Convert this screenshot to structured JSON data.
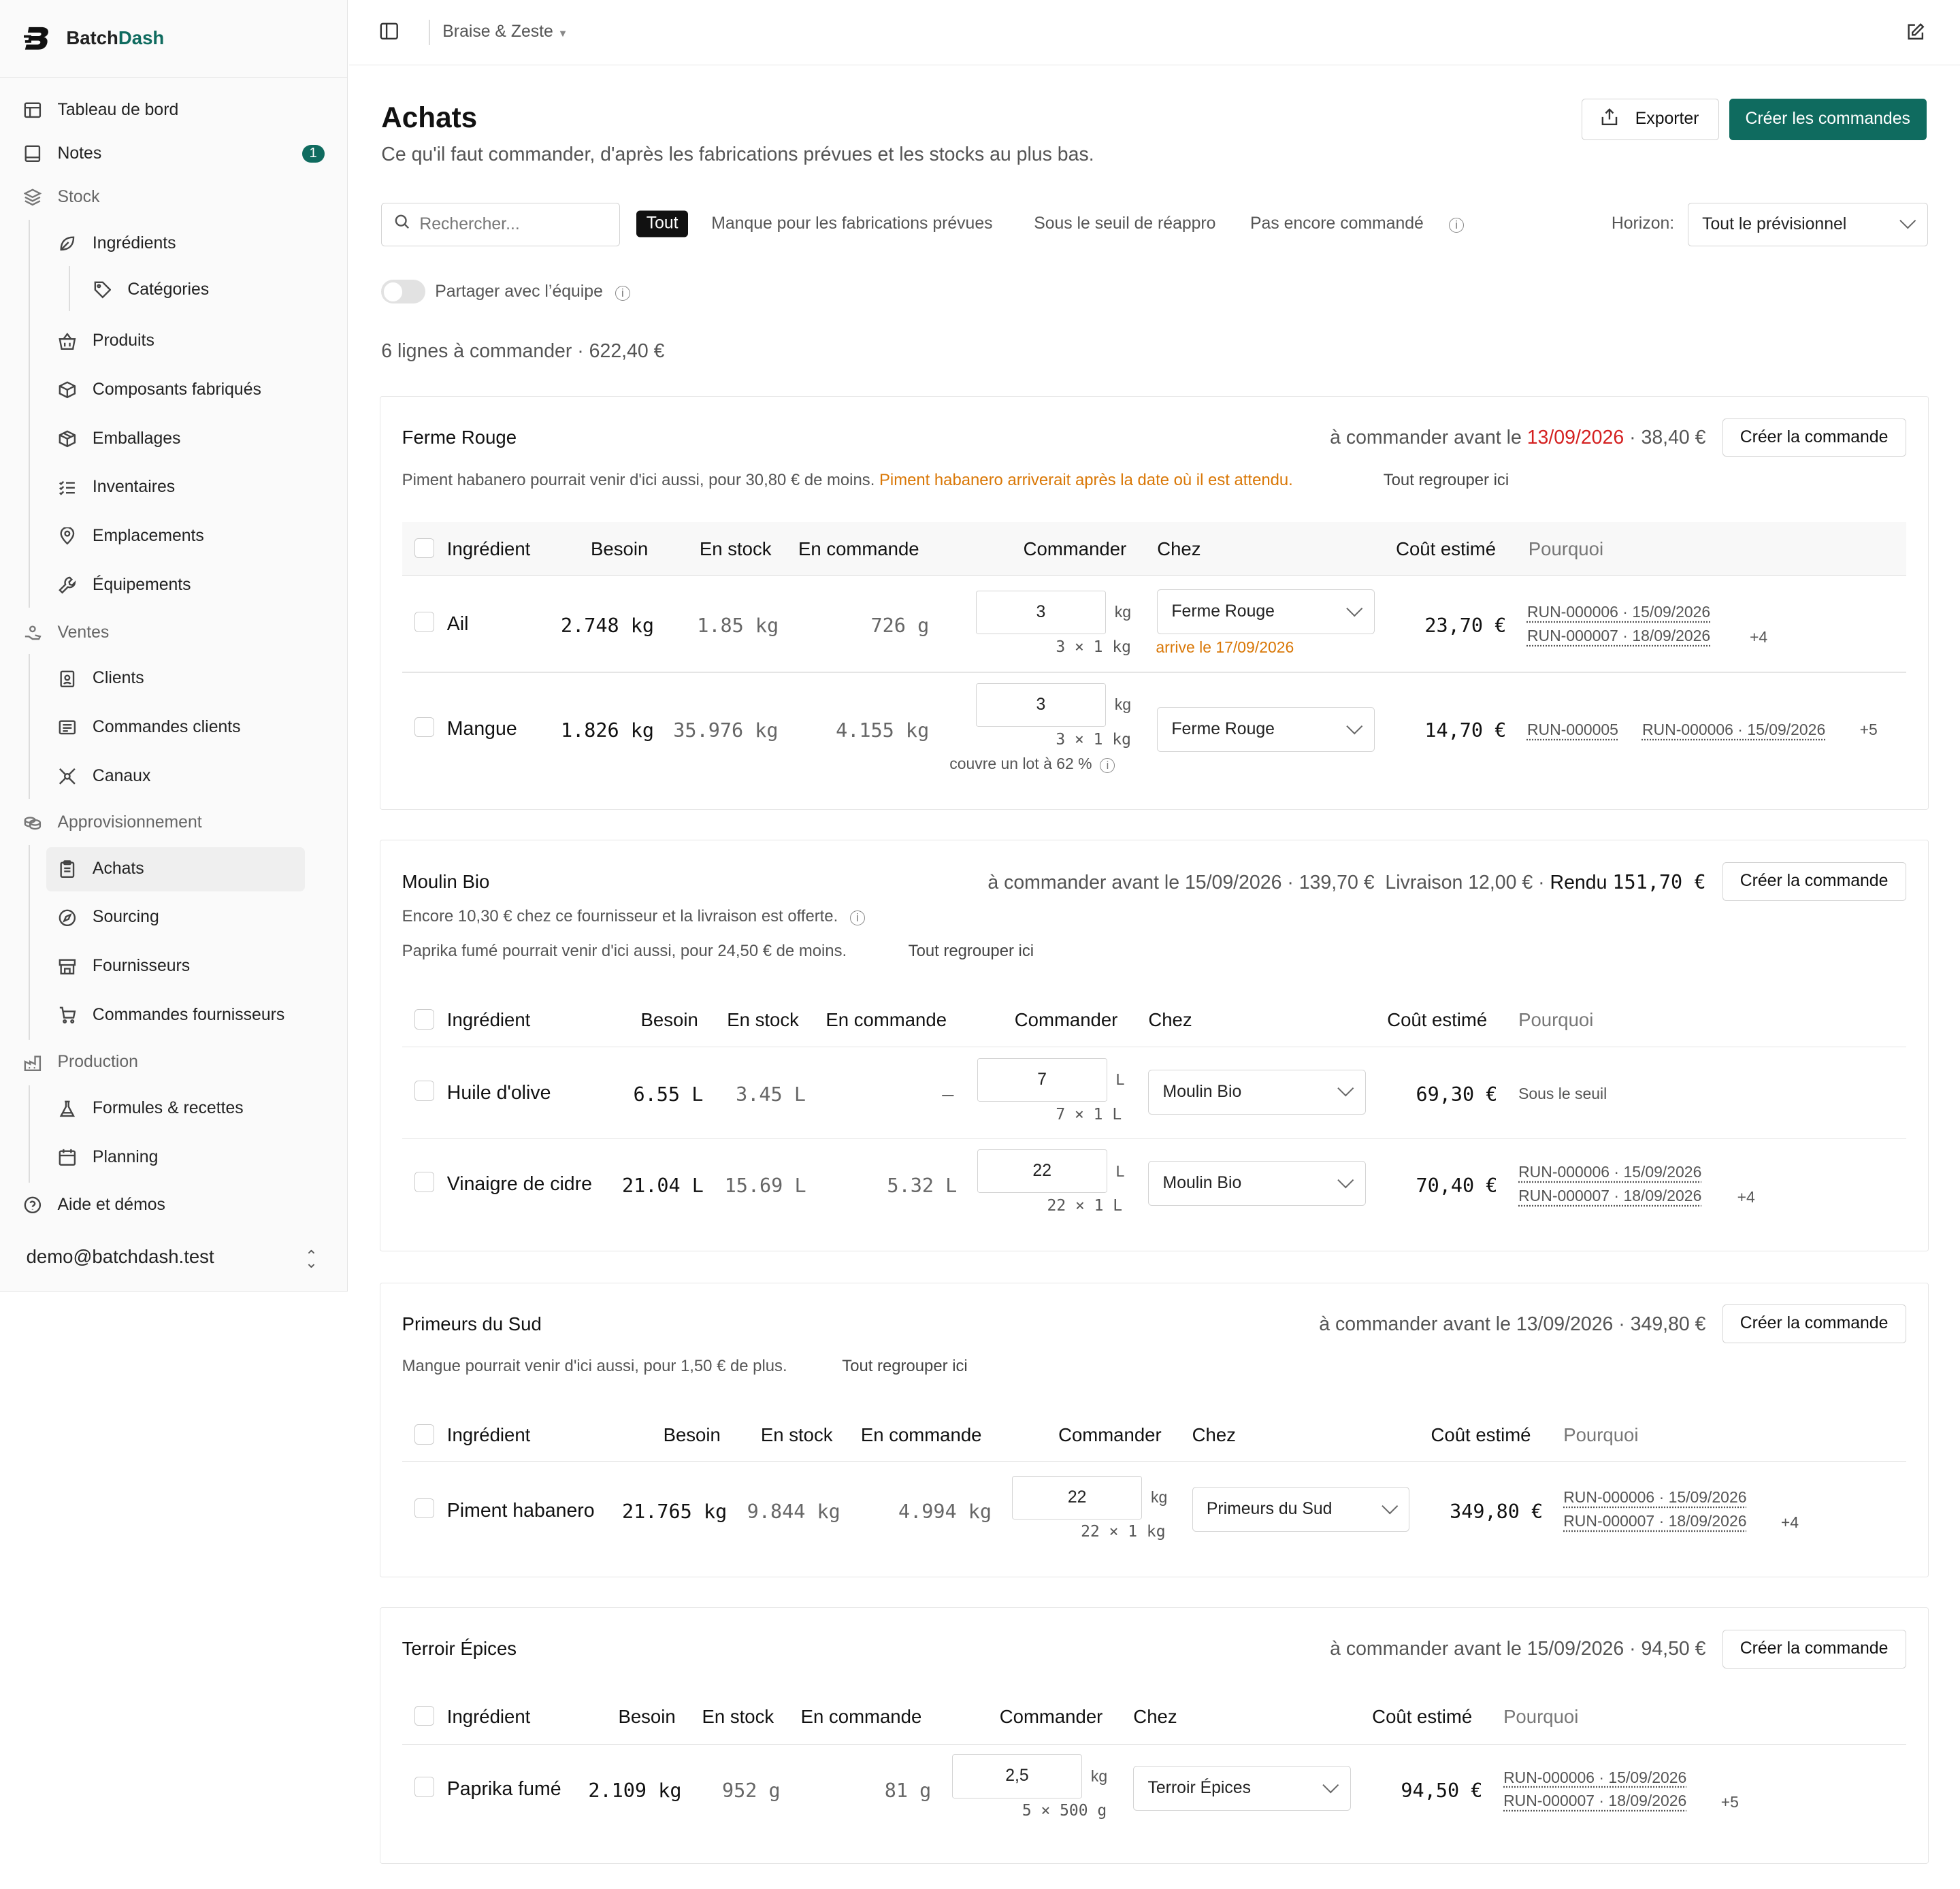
{
  "app": {
    "name_a": "Batch",
    "name_b": "Dash",
    "workspace": "Braise & Zeste"
  },
  "nav": {
    "dashboard": "Tableau de bord",
    "notes": "Notes",
    "notes_badge": "1",
    "stock": "Stock",
    "ingredients": "Ingrédients",
    "categories": "Catégories",
    "products": "Produits",
    "components": "Composants fabriqués",
    "packaging": "Emballages",
    "inventories": "Inventaires",
    "locations": "Emplacements",
    "equipment": "Équipements",
    "sales": "Ventes",
    "clients": "Clients",
    "client_orders": "Commandes clients",
    "channels": "Canaux",
    "supply": "Approvisionnement",
    "purchases": "Achats",
    "sourcing": "Sourcing",
    "suppliers": "Fournisseurs",
    "supplier_orders": "Commandes fournisseurs",
    "production": "Production",
    "recipes": "Formules & recettes",
    "planning": "Planning",
    "help": "Aide et démos",
    "user": "demo@batchdash.test"
  },
  "page": {
    "title": "Achats",
    "subtitle": "Ce qu'il faut commander, d'après les fabrications prévues et les stocks au plus bas.",
    "export": "Exporter",
    "create_all": "Créer les commandes",
    "search_placeholder": "Rechercher...",
    "filters": [
      "Tout",
      "Manque pour les fabrications prévues",
      "Sous le seuil de réappro",
      "Pas encore commandé"
    ],
    "horizon_label": "Horizon:",
    "horizon_value": "Tout le prévisionnel",
    "share": "Partager avec l’équipe",
    "summary": "6 lignes à commander · 622,40 €"
  },
  "cols": {
    "ingredient": "Ingrédient",
    "need": "Besoin",
    "stock": "En stock",
    "ordered": "En commande",
    "order": "Commander",
    "from": "Chez",
    "cost": "Coût estimé",
    "why": "Pourquoi"
  },
  "create_order": "Créer la commande",
  "group_here": "Tout regrouper ici",
  "s1": {
    "name": "Ferme Rouge",
    "deadline_pre": "à commander avant le",
    "date": "13/09/2026",
    "total": "· 38,40 €",
    "note": "Piment habanero pourrait venir d'ici aussi, pour 30,80 € de moins.",
    "warn": "Piment habanero arriverait après la date où il est attendu.",
    "r1": {
      "name": "Ail",
      "need": "2.748 kg",
      "stock": "1.85 kg",
      "ordered": "726 g",
      "qty": "3",
      "unit": "kg",
      "pack": "3 × 1 kg",
      "arrive": "arrive le 17/09/2026",
      "supplier": "Ferme Rouge",
      "cost": "23,70 €",
      "why1": "RUN-000006 · 15/09/2026",
      "why2": "RUN-000007 · 18/09/2026",
      "more": "+4"
    },
    "r2": {
      "name": "Mangue",
      "need": "1.826 kg",
      "stock": "35.976 kg",
      "ordered": "4.155 kg",
      "qty": "3",
      "unit": "kg",
      "pack": "3 × 1 kg",
      "cover": "couvre un lot à 62 %",
      "supplier": "Ferme Rouge",
      "cost": "14,70 €",
      "why1": "RUN-000005",
      "why2": "RUN-000006 · 15/09/2026",
      "more": "+5"
    }
  },
  "s2": {
    "name": "Moulin Bio",
    "deadline": "à commander avant le 15/09/2026 · 139,70 €",
    "delivery": "Livraison 12,00 €",
    "dot": "·",
    "rendu_label": "Rendu",
    "rendu": "151,70 €",
    "note1": "Encore 10,30 € chez ce fournisseur et la livraison est offerte.",
    "note2": "Paprika fumé pourrait venir d'ici aussi, pour 24,50 € de moins.",
    "r1": {
      "name": "Huile d'olive",
      "need": "6.55 L",
      "stock": "3.45 L",
      "ordered": "–",
      "qty": "7",
      "unit": "L",
      "pack": "7 × 1 L",
      "supplier": "Moulin Bio",
      "cost": "69,30 €",
      "why": "Sous le seuil"
    },
    "r2": {
      "name": "Vinaigre de cidre",
      "need": "21.04 L",
      "stock": "15.69 L",
      "ordered": "5.32 L",
      "qty": "22",
      "unit": "L",
      "pack": "22 × 1 L",
      "supplier": "Moulin Bio",
      "cost": "70,40 €",
      "why1": "RUN-000006 · 15/09/2026",
      "why2": "RUN-000007 · 18/09/2026",
      "more": "+4"
    }
  },
  "s3": {
    "name": "Primeurs du Sud",
    "deadline": "à commander avant le 13/09/2026 · 349,80 €",
    "note": "Mangue pourrait venir d'ici aussi, pour 1,50 € de plus.",
    "r1": {
      "name": "Piment habanero",
      "need": "21.765 kg",
      "stock": "9.844 kg",
      "ordered": "4.994 kg",
      "qty": "22",
      "unit": "kg",
      "pack": "22 × 1 kg",
      "supplier": "Primeurs du Sud",
      "cost": "349,80 €",
      "why1": "RUN-000006 · 15/09/2026",
      "why2": "RUN-000007 · 18/09/2026",
      "more": "+4"
    }
  },
  "s4": {
    "name": "Terroir Épices",
    "deadline": "à commander avant le 15/09/2026 · 94,50 €",
    "r1": {
      "name": "Paprika fumé",
      "need": "2.109 kg",
      "stock": "952 g",
      "ordered": "81 g",
      "qty": "2,5",
      "unit": "kg",
      "pack": "5 × 500 g",
      "supplier": "Terroir Épices",
      "cost": "94,50 €",
      "why1": "RUN-000006 · 15/09/2026",
      "why2": "RUN-000007 · 18/09/2026",
      "more": "+5"
    }
  },
  "colors": {
    "accent": "#0f6b5f",
    "warning": "#d97706",
    "danger": "#d42020"
  }
}
